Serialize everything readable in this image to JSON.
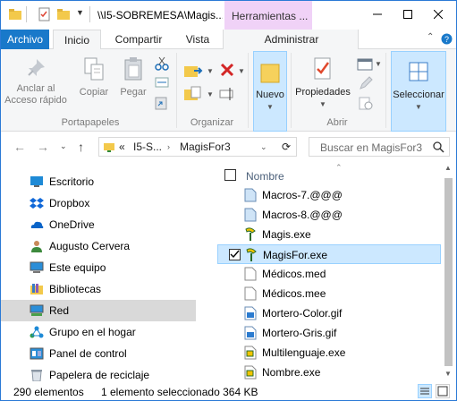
{
  "window": {
    "title": "\\\\I5-SOBREMESA\\Magis...",
    "context_tab_group": "Herramientas ..."
  },
  "tabs": {
    "file": "Archivo",
    "home": "Inicio",
    "share": "Compartir",
    "view": "Vista",
    "manage": "Administrar"
  },
  "ribbon": {
    "pin": "Anclar al Acceso rápido",
    "copy": "Copiar",
    "paste": "Pegar",
    "new": "Nuevo",
    "properties": "Propiedades",
    "select": "Seleccionar",
    "groups": {
      "clipboard": "Portapapeles",
      "organize": "Organizar",
      "open": "Abrir"
    }
  },
  "address": {
    "chevron": "«",
    "crumb1": "I5-S...",
    "crumb2": "MagisFor3",
    "search_placeholder": "Buscar en MagisFor3"
  },
  "nav": [
    {
      "label": "Escritorio",
      "icon": "desktop-icon"
    },
    {
      "label": "Dropbox",
      "icon": "dropbox-icon"
    },
    {
      "label": "OneDrive",
      "icon": "onedrive-icon"
    },
    {
      "label": "Augusto Cervera",
      "icon": "user-icon"
    },
    {
      "label": "Este equipo",
      "icon": "computer-icon"
    },
    {
      "label": "Bibliotecas",
      "icon": "libraries-icon"
    },
    {
      "label": "Red",
      "icon": "network-icon",
      "selected": true
    },
    {
      "label": "Grupo en el hogar",
      "icon": "homegroup-icon"
    },
    {
      "label": "Panel de control",
      "icon": "control-panel-icon"
    },
    {
      "label": "Papelera de reciclaje",
      "icon": "recycle-bin-icon"
    }
  ],
  "list": {
    "column": "Nombre",
    "files": [
      {
        "name": "Macros-7.@@@",
        "icon": "data-file-icon"
      },
      {
        "name": "Macros-8.@@@",
        "icon": "data-file-icon"
      },
      {
        "name": "Magis.exe",
        "icon": "magis-exe-icon"
      },
      {
        "name": "MagisFor.exe",
        "icon": "magis-exe-icon",
        "selected": true
      },
      {
        "name": "Médicos.med",
        "icon": "blank-file-icon"
      },
      {
        "name": "Médicos.mee",
        "icon": "blank-file-icon"
      },
      {
        "name": "Mortero-Color.gif",
        "icon": "image-file-icon"
      },
      {
        "name": "Mortero-Gris.gif",
        "icon": "image-file-icon"
      },
      {
        "name": "Multilenguaje.exe",
        "icon": "exe-file-icon"
      },
      {
        "name": "Nombre.exe",
        "icon": "exe-file-icon"
      }
    ]
  },
  "status": {
    "count": "290 elementos",
    "selection": "1 elemento seleccionado  364 KB"
  },
  "colors": {
    "accent": "#1979ca",
    "context_tab": "#f0d2f7",
    "selection": "#cce8ff",
    "nav_selected": "#d9d9d9"
  }
}
